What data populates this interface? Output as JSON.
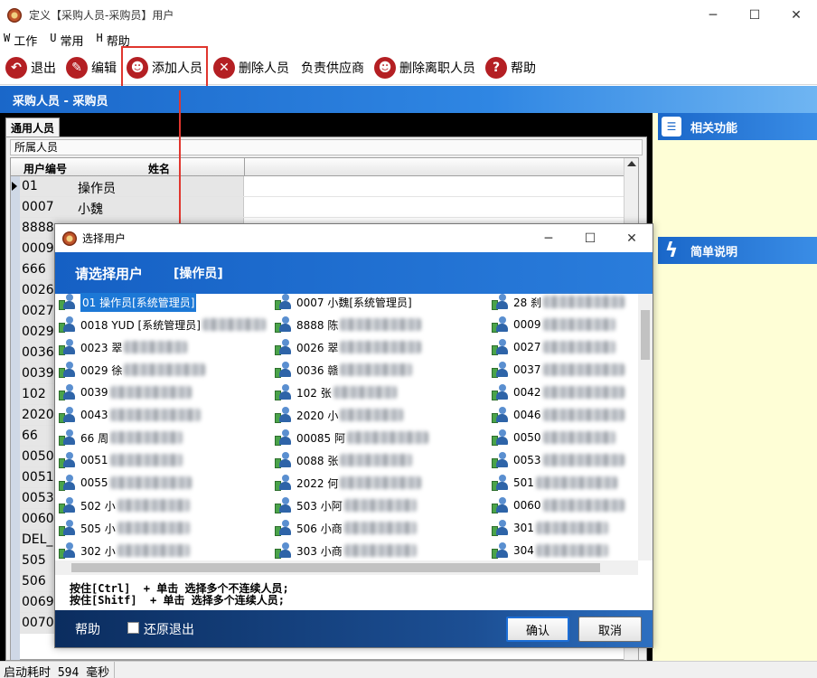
{
  "window": {
    "title": "定义【采购人员-采购员】用户",
    "controls": {
      "minimize": "─",
      "maximize": "☐",
      "close": "✕"
    }
  },
  "menu": [
    {
      "key": "W",
      "label": "工作"
    },
    {
      "key": "U",
      "label": "常用"
    },
    {
      "key": "H",
      "label": "帮助"
    }
  ],
  "toolbar": {
    "exit": "退出",
    "edit": "编辑",
    "add_person": "添加人员",
    "delete_person": "删除人员",
    "responsible_supplier": "负责供应商",
    "delete_resigned": "删除离职人员",
    "help": "帮助"
  },
  "breadcrumb": "采购人员 - 采购员",
  "left_panel": {
    "tab": "通用人员",
    "group_caption": "所属人员",
    "columns": [
      "用户编号",
      "姓名"
    ],
    "rows": [
      {
        "code": "01",
        "name": "操作员"
      },
      {
        "code": "0007",
        "name": "小魏"
      },
      {
        "code": "8888",
        "name": ""
      },
      {
        "code": "0009",
        "name": ""
      },
      {
        "code": "666",
        "name": ""
      },
      {
        "code": "0026",
        "name": ""
      },
      {
        "code": "0027",
        "name": ""
      },
      {
        "code": "0029",
        "name": ""
      },
      {
        "code": "0036",
        "name": ""
      },
      {
        "code": "0039",
        "name": ""
      },
      {
        "code": "102",
        "name": ""
      },
      {
        "code": "2020",
        "name": ""
      },
      {
        "code": "66",
        "name": ""
      },
      {
        "code": "0050",
        "name": ""
      },
      {
        "code": "0051",
        "name": ""
      },
      {
        "code": "0053",
        "name": ""
      },
      {
        "code": "0060",
        "name": ""
      },
      {
        "code": "DEL_",
        "name": ""
      },
      {
        "code": "505",
        "name": ""
      },
      {
        "code": "506",
        "name": ""
      },
      {
        "code": "0069",
        "name": ""
      },
      {
        "code": "0070",
        "name": ""
      }
    ]
  },
  "right_panel": {
    "related_functions": "相关功能",
    "brief_description": "简单说明"
  },
  "status_bar": {
    "startup_time": "启动耗时 594 毫秒"
  },
  "dialog": {
    "title": "选择用户",
    "controls": {
      "minimize": "─",
      "maximize": "☐",
      "close": "✕"
    },
    "banner_prompt": "请选择用户",
    "banner_current": "[操作员]",
    "users": [
      [
        "01 操作员[系统管理员]",
        "0007 小魏[系统管理员]",
        "28 刹"
      ],
      [
        "0018 YUD [系统管理员]",
        "8888 陈",
        "0009"
      ],
      [
        "0023 翠",
        "0026 翠",
        "0027"
      ],
      [
        "0029 徐",
        "0036 赣",
        "0037"
      ],
      [
        "0039",
        "102 张",
        "0042"
      ],
      [
        "0043",
        "2020 小",
        "0046"
      ],
      [
        "66 周",
        "00085 阿",
        "0050"
      ],
      [
        "0051",
        "0088 张",
        "0053"
      ],
      [
        "0055",
        "2022 何",
        "501"
      ],
      [
        "502 小",
        "503 小阿",
        "0060"
      ],
      [
        "505 小",
        "506 小商",
        "301"
      ],
      [
        "302 小",
        "303 小商",
        "304"
      ]
    ],
    "hint_ctrl": "按住[Ctrl]  + 单击 选择多个不连续人员;",
    "hint_shift": "按住[Shitf]  + 单击 选择多个连续人员;",
    "footer_help": "帮助",
    "restore_exit": "还原退出",
    "confirm": "确认",
    "cancel": "取消"
  },
  "colors": {
    "accent_blue": "#1a67c9",
    "highlight_red": "#e0362e",
    "toolbar_icon_red": "#b41f23",
    "info_panel_bg": "#fefed6"
  }
}
